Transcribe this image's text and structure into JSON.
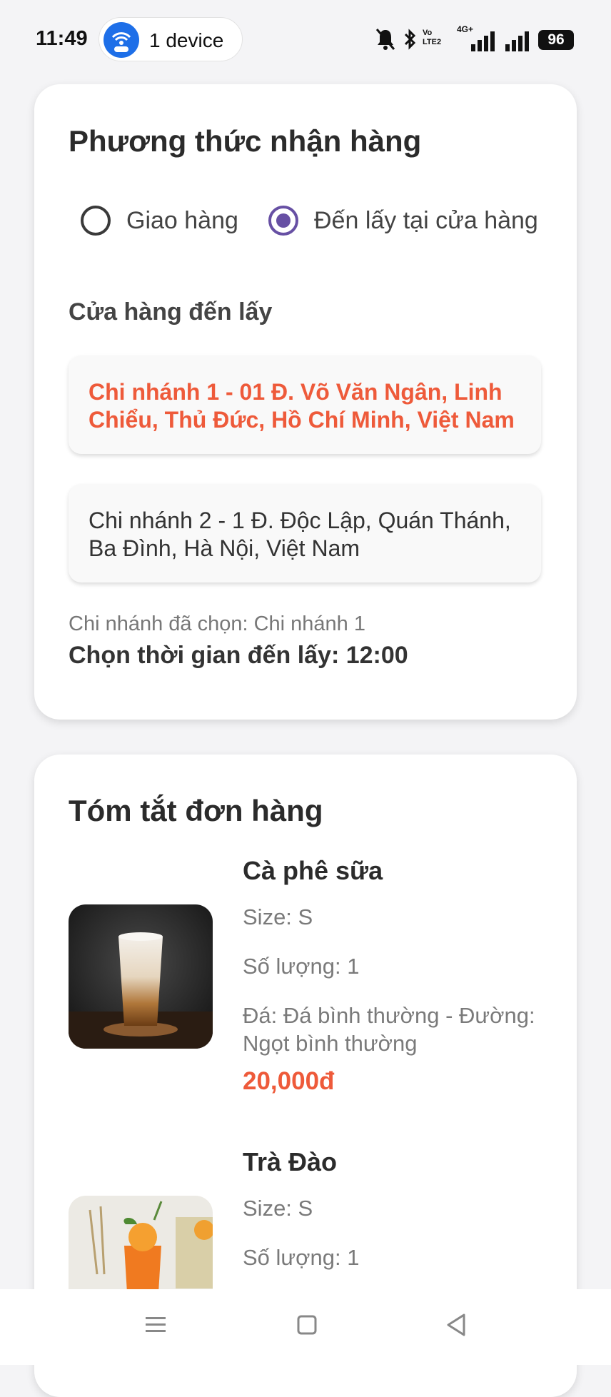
{
  "status_bar": {
    "time": "11:49",
    "hotspot_label": "1 device",
    "battery": "96",
    "net_tag": "4G+",
    "volte_tag": "Vo LTE2"
  },
  "delivery": {
    "title": "Phương thức nhận hàng",
    "options": [
      {
        "label": "Giao hàng",
        "selected": false
      },
      {
        "label": "Đến lấy tại cửa hàng",
        "selected": true
      }
    ],
    "stores_label": "Cửa hàng đến lấy",
    "stores": [
      {
        "label": "Chi nhánh 1 - 01 Đ. Võ Văn Ngân, Linh Chiểu, Thủ Đức, Hồ Chí Minh, Việt Nam",
        "selected": true
      },
      {
        "label": "Chi nhánh 2 - 1 Đ. Độc Lập, Quán Thánh, Ba Đình, Hà Nội, Việt Nam",
        "selected": false
      }
    ],
    "selected_store_text": "Chi nhánh đã chọn: Chi nhánh 1",
    "pickup_time_text": "Chọn thời gian đến lấy: 12:00"
  },
  "summary": {
    "title": "Tóm tắt đơn hàng",
    "items": [
      {
        "name": "Cà phê sữa",
        "size": "Size: S",
        "quantity": "Số lượng: 1",
        "options": "Đá: Đá bình thường - Đường: Ngọt bình thường",
        "price": "20,000đ"
      },
      {
        "name": "Trà Đào",
        "size": "Size: S",
        "quantity": "Số lượng: 1"
      }
    ]
  },
  "colors": {
    "accent": "#ee5a3a",
    "radio": "#6750a4"
  }
}
